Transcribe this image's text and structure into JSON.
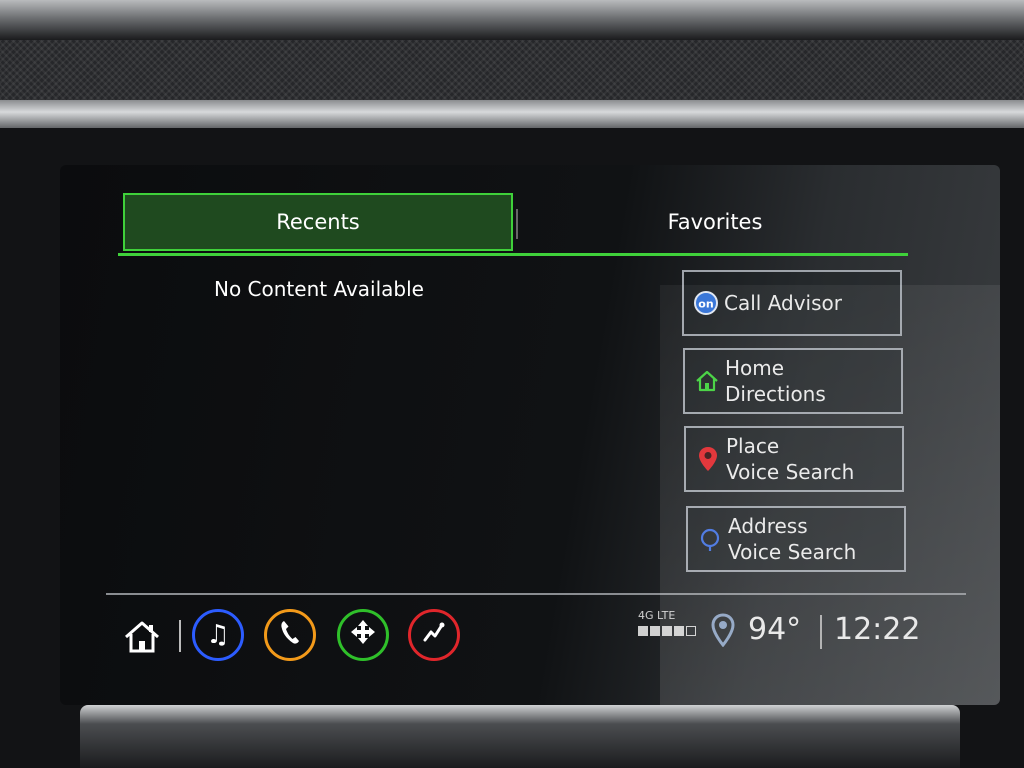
{
  "tabs": {
    "recents_label": "Recents",
    "favorites_label": "Favorites"
  },
  "main": {
    "empty_message": "No Content Available"
  },
  "actions": [
    {
      "line1": "Call Advisor",
      "line2": "",
      "icon": "onstar-icon"
    },
    {
      "line1": "Home",
      "line2": "Directions",
      "icon": "home-icon"
    },
    {
      "line1": "Place",
      "line2": "Voice Search",
      "icon": "location-pin-icon"
    },
    {
      "line1": "Address",
      "line2": "Voice Search",
      "icon": "address-pin-icon"
    }
  ],
  "status": {
    "network": "4G LTE",
    "signal_bars": 4,
    "temperature": "94°",
    "time": "12:22"
  },
  "nav": {
    "icons": [
      "home-icon",
      "music-icon",
      "phone-icon",
      "navigation-icon",
      "apps-icon"
    ]
  },
  "colors": {
    "accent_green": "#3fd13a",
    "audio_blue": "#2c5cff",
    "phone_orange": "#f39a1a",
    "nav_green": "#2fc02a",
    "apps_red": "#e0262b"
  }
}
